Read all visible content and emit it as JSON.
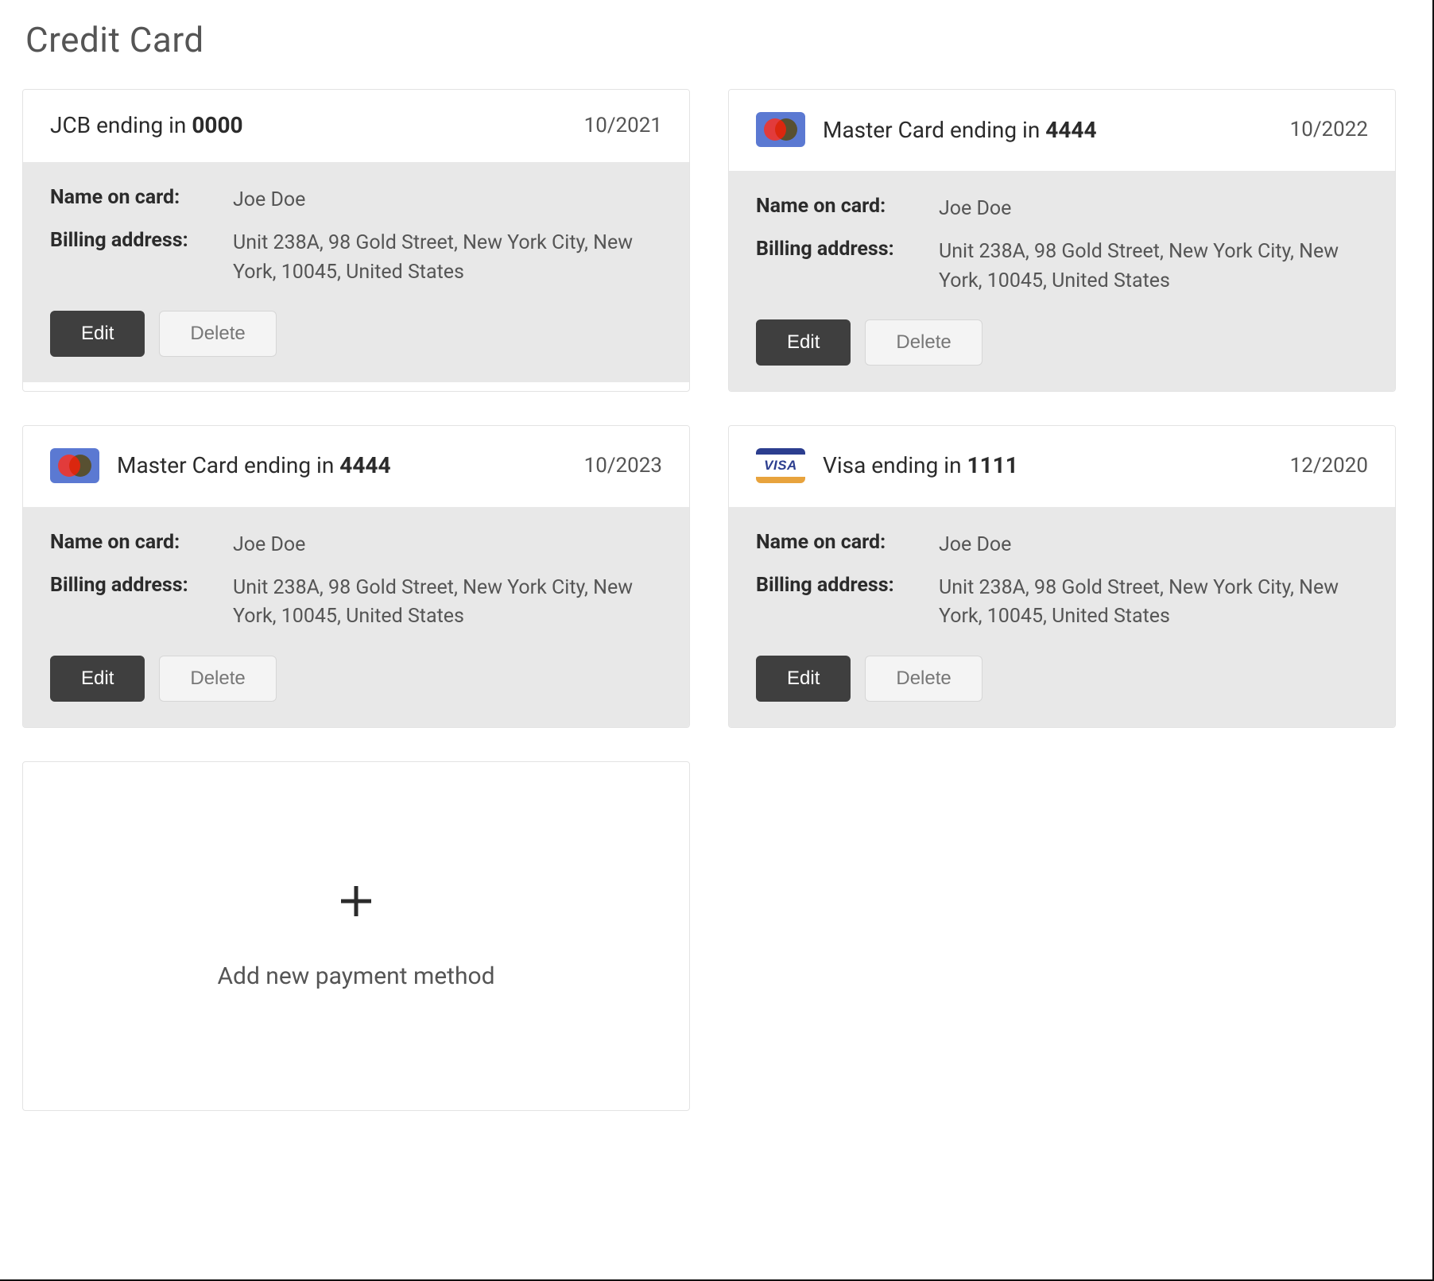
{
  "page_title": "Credit Card",
  "labels": {
    "name_on_card": "Name on card:",
    "billing_address": "Billing address:",
    "edit": "Edit",
    "delete": "Delete",
    "add_new": "Add new payment method"
  },
  "cards": [
    {
      "brand": "jcb",
      "title_prefix": "JCB ending in ",
      "last4": "0000",
      "expiry": "10/2021",
      "name_on_card": "Joe Doe",
      "billing_address": "Unit 238A, 98 Gold Street, New York City, New York, 10045, United States"
    },
    {
      "brand": "mastercard",
      "title_prefix": "Master Card ending in ",
      "last4": "4444",
      "expiry": "10/2022",
      "name_on_card": "Joe Doe",
      "billing_address": "Unit 238A, 98 Gold Street, New York City, New York, 10045, United States"
    },
    {
      "brand": "mastercard",
      "title_prefix": "Master Card ending in ",
      "last4": "4444",
      "expiry": "10/2023",
      "name_on_card": "Joe Doe",
      "billing_address": "Unit 238A, 98 Gold Street, New York City, New York, 10045, United States"
    },
    {
      "brand": "visa",
      "title_prefix": "Visa ending in ",
      "last4": "1111",
      "expiry": "12/2020",
      "name_on_card": "Joe Doe",
      "billing_address": "Unit 238A, 98 Gold Street, New York City, New York, 10045, United States"
    }
  ]
}
